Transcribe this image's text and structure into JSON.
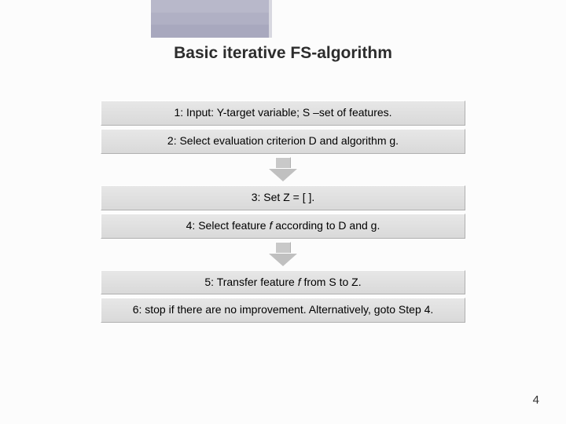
{
  "title": "Basic iterative FS-algorithm",
  "steps": [
    {
      "text": "1: Input: Y-target variable; S –set of features."
    },
    {
      "text": "2: Select evaluation criterion D and algorithm g."
    },
    {
      "text": "3: Set Z = [ ]."
    },
    {
      "pre": "4: Select feature ",
      "ital": "f",
      "post": " according to D and g."
    },
    {
      "pre": "5: Transfer feature ",
      "ital": "f",
      "post": "  from S to Z."
    },
    {
      "text": "6: stop if there are no improvement. Alternatively, goto Step 4."
    }
  ],
  "page_number": "4"
}
